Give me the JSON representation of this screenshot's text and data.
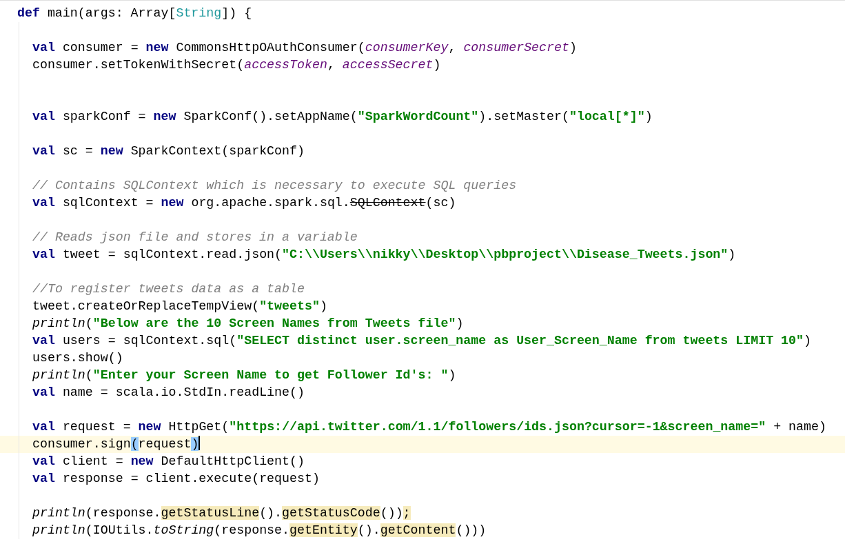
{
  "editor": {
    "lines": [
      {
        "kind": "code",
        "current": false,
        "tokens": [
          {
            "t": "def",
            "kind": "kw"
          },
          {
            "t": " main(args: Array[",
            "kind": "plain"
          },
          {
            "t": "String",
            "kind": "type"
          },
          {
            "t": "]) {",
            "kind": "plain"
          }
        ],
        "children": [
          {
            "kind": "blank"
          },
          {
            "kind": "code",
            "current": false,
            "tokens": [
              {
                "t": "val",
                "kind": "kw"
              },
              {
                "t": " consumer = ",
                "kind": "plain"
              },
              {
                "t": "new",
                "kind": "kw"
              },
              {
                "t": " CommonsHttpOAuthConsumer(",
                "kind": "plain"
              },
              {
                "t": "consumerKey",
                "kind": "param"
              },
              {
                "t": ", ",
                "kind": "plain"
              },
              {
                "t": "consumerSecret",
                "kind": "param"
              },
              {
                "t": ")",
                "kind": "plain"
              }
            ]
          },
          {
            "kind": "code",
            "current": false,
            "tokens": [
              {
                "t": "consumer.setTokenWithSecret(",
                "kind": "plain"
              },
              {
                "t": "accessToken",
                "kind": "param"
              },
              {
                "t": ", ",
                "kind": "plain"
              },
              {
                "t": "accessSecret",
                "kind": "param"
              },
              {
                "t": ")",
                "kind": "plain"
              }
            ]
          },
          {
            "kind": "blank"
          },
          {
            "kind": "blank"
          },
          {
            "kind": "code",
            "current": false,
            "tokens": [
              {
                "t": "val",
                "kind": "kw"
              },
              {
                "t": " sparkConf = ",
                "kind": "plain"
              },
              {
                "t": "new",
                "kind": "kw"
              },
              {
                "t": " SparkConf().setAppName(",
                "kind": "plain"
              },
              {
                "t": "\"SparkWordCount\"",
                "kind": "str"
              },
              {
                "t": ").setMaster(",
                "kind": "plain"
              },
              {
                "t": "\"local[*]\"",
                "kind": "str"
              },
              {
                "t": ")",
                "kind": "plain"
              }
            ]
          },
          {
            "kind": "blank"
          },
          {
            "kind": "code",
            "current": false,
            "tokens": [
              {
                "t": "val",
                "kind": "kw"
              },
              {
                "t": " sc = ",
                "kind": "plain"
              },
              {
                "t": "new",
                "kind": "kw"
              },
              {
                "t": " SparkContext(sparkConf)",
                "kind": "plain"
              }
            ]
          },
          {
            "kind": "blank"
          },
          {
            "kind": "code",
            "current": false,
            "tokens": [
              {
                "t": "// Contains SQLContext which is necessary to execute SQL queries",
                "kind": "comment"
              }
            ]
          },
          {
            "kind": "code",
            "current": false,
            "tokens": [
              {
                "t": "val",
                "kind": "kw"
              },
              {
                "t": " sqlContext = ",
                "kind": "plain"
              },
              {
                "t": "new",
                "kind": "kw"
              },
              {
                "t": " org.apache.spark.sql.",
                "kind": "plain"
              },
              {
                "t": "SQLContext",
                "kind": "deprecated"
              },
              {
                "t": "(sc)",
                "kind": "plain"
              }
            ]
          },
          {
            "kind": "blank"
          },
          {
            "kind": "code",
            "current": false,
            "tokens": [
              {
                "t": "// Reads json file and stores in a variable",
                "kind": "comment"
              }
            ]
          },
          {
            "kind": "code",
            "current": false,
            "tokens": [
              {
                "t": "val",
                "kind": "kw"
              },
              {
                "t": " tweet = sqlContext.read.json(",
                "kind": "plain"
              },
              {
                "t": "\"C:\\\\Users\\\\nikky\\\\Desktop\\\\pbproject\\\\Disease_Tweets.json\"",
                "kind": "str"
              },
              {
                "t": ")",
                "kind": "plain"
              }
            ]
          },
          {
            "kind": "blank"
          },
          {
            "kind": "code",
            "current": false,
            "tokens": [
              {
                "t": "//To register tweets data as a table",
                "kind": "comment"
              }
            ]
          },
          {
            "kind": "code",
            "current": false,
            "tokens": [
              {
                "t": "tweet.createOrReplaceTempView(",
                "kind": "plain"
              },
              {
                "t": "\"tweets\"",
                "kind": "str"
              },
              {
                "t": ")",
                "kind": "plain"
              }
            ]
          },
          {
            "kind": "code",
            "current": false,
            "tokens": [
              {
                "t": "println",
                "kind": "call"
              },
              {
                "t": "(",
                "kind": "plain"
              },
              {
                "t": "\"Below are the 10 Screen Names from Tweets file\"",
                "kind": "str"
              },
              {
                "t": ")",
                "kind": "plain"
              }
            ]
          },
          {
            "kind": "code",
            "current": false,
            "tokens": [
              {
                "t": "val",
                "kind": "kw"
              },
              {
                "t": " users = sqlContext.sql(",
                "kind": "plain"
              },
              {
                "t": "\"SELECT distinct user.screen_name as User_Screen_Name from tweets LIMIT 10\"",
                "kind": "str"
              },
              {
                "t": ")",
                "kind": "plain"
              }
            ]
          },
          {
            "kind": "code",
            "current": false,
            "tokens": [
              {
                "t": "users.show()",
                "kind": "plain"
              }
            ]
          },
          {
            "kind": "code",
            "current": false,
            "tokens": [
              {
                "t": "println",
                "kind": "call"
              },
              {
                "t": "(",
                "kind": "plain"
              },
              {
                "t": "\"Enter your Screen Name to get Follower Id's: \"",
                "kind": "str"
              },
              {
                "t": ")",
                "kind": "plain"
              }
            ]
          },
          {
            "kind": "code",
            "current": false,
            "tokens": [
              {
                "t": "val",
                "kind": "kw"
              },
              {
                "t": " name = scala.io.StdIn.readLine()",
                "kind": "plain"
              }
            ]
          },
          {
            "kind": "blank"
          },
          {
            "kind": "code",
            "current": false,
            "tokens": [
              {
                "t": "val",
                "kind": "kw"
              },
              {
                "t": " request = ",
                "kind": "plain"
              },
              {
                "t": "new",
                "kind": "kw"
              },
              {
                "t": " HttpGet(",
                "kind": "plain"
              },
              {
                "t": "\"https://api.twitter.com/1.1/followers/ids.json?cursor=-1&screen_name=\"",
                "kind": "str"
              },
              {
                "t": " + name)",
                "kind": "plain"
              }
            ]
          },
          {
            "kind": "code",
            "current": true,
            "tokens": [
              {
                "t": "consumer.sign",
                "kind": "plain"
              },
              {
                "t": "(",
                "kind": "match"
              },
              {
                "t": "request",
                "kind": "plain"
              },
              {
                "t": ")",
                "kind": "match"
              }
            ]
          },
          {
            "kind": "code",
            "current": false,
            "tokens": [
              {
                "t": "val",
                "kind": "kw"
              },
              {
                "t": " client = ",
                "kind": "plain"
              },
              {
                "t": "new",
                "kind": "kw"
              },
              {
                "t": " DefaultHttpClient()",
                "kind": "plain"
              }
            ]
          },
          {
            "kind": "code",
            "current": false,
            "tokens": [
              {
                "t": "val",
                "kind": "kw"
              },
              {
                "t": " response = client.execute(request)",
                "kind": "plain"
              }
            ]
          },
          {
            "kind": "blank"
          },
          {
            "kind": "code",
            "current": false,
            "tokens": [
              {
                "t": "println",
                "kind": "call"
              },
              {
                "t": "(response.",
                "kind": "plain"
              },
              {
                "t": "getStatusLine",
                "kind": "warn"
              },
              {
                "t": "().",
                "kind": "plain"
              },
              {
                "t": "getStatusCode",
                "kind": "warn"
              },
              {
                "t": "())",
                "kind": "plain"
              },
              {
                "t": ";",
                "kind": "warn"
              }
            ]
          },
          {
            "kind": "code",
            "current": false,
            "tokens": [
              {
                "t": "println",
                "kind": "call"
              },
              {
                "t": "(IOUtils.",
                "kind": "plain"
              },
              {
                "t": "toString",
                "kind": "call"
              },
              {
                "t": "(response.",
                "kind": "plain"
              },
              {
                "t": "getEntity",
                "kind": "warn"
              },
              {
                "t": "().",
                "kind": "plain"
              },
              {
                "t": "getContent",
                "kind": "warn"
              },
              {
                "t": "()))",
                "kind": "plain"
              }
            ]
          }
        ]
      }
    ]
  }
}
